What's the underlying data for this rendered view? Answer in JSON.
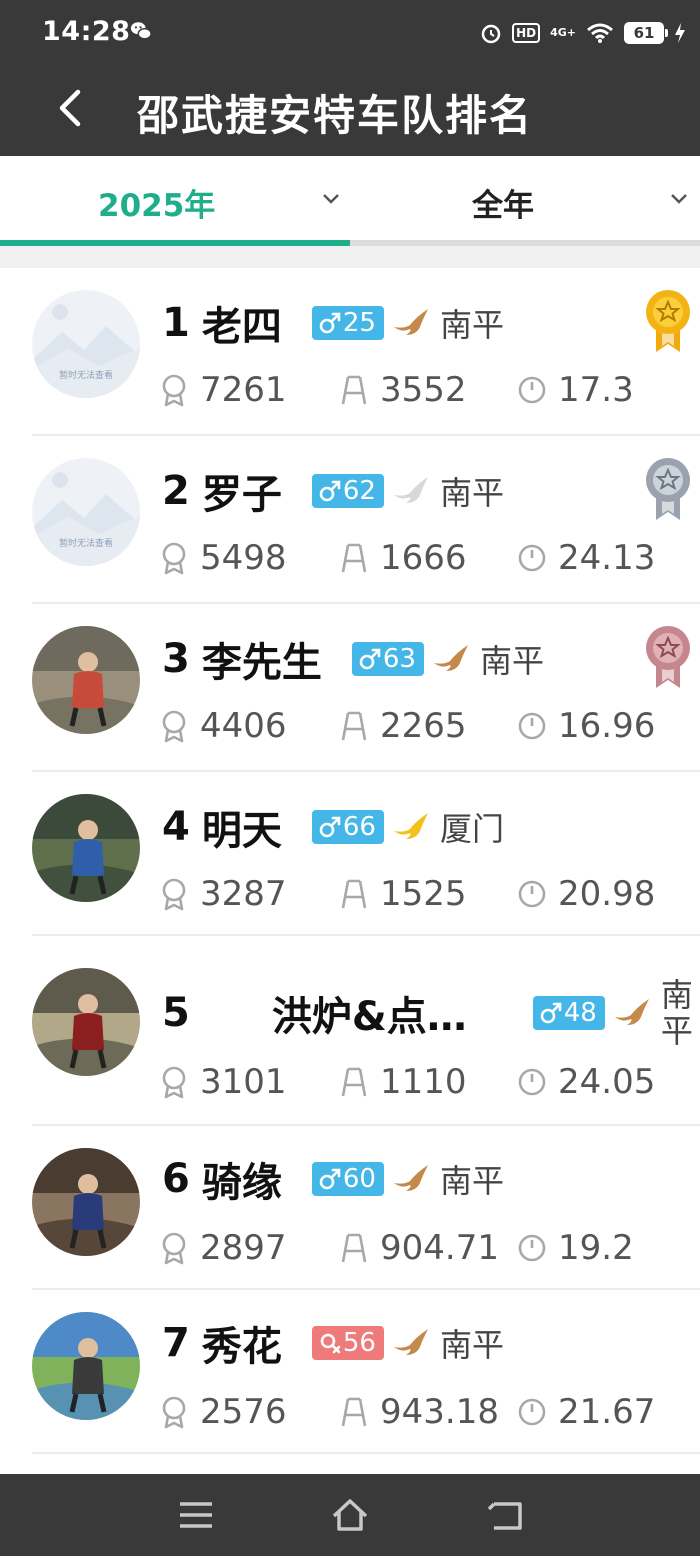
{
  "status": {
    "time": "14:28",
    "network": "4G+",
    "battery": "61"
  },
  "header": {
    "title": "邵武捷安特车队排名"
  },
  "tabs": [
    {
      "label": "2025年",
      "active": true
    },
    {
      "label": "全年",
      "active": false
    }
  ],
  "avatar_placeholder_text": "暂时无法查看",
  "colors": {
    "accent": "#1fae8c",
    "male_badge": "#45b6e8",
    "female_badge": "#ef7a7a",
    "header_bg": "#393939"
  },
  "riders": [
    {
      "rank": "1",
      "name": "老四",
      "gender": "male",
      "age": "25",
      "bird": "brown",
      "city": "南平",
      "stat1": "7261",
      "stat2": "3552",
      "stat3": "17.3",
      "medal": "gold",
      "avatar": "placeholder"
    },
    {
      "rank": "2",
      "name": "罗子",
      "gender": "male",
      "age": "62",
      "bird": "white",
      "city": "南平",
      "stat1": "5498",
      "stat2": "1666",
      "stat3": "24.13",
      "medal": "silver",
      "avatar": "placeholder"
    },
    {
      "rank": "3",
      "name": "李先生",
      "gender": "male",
      "age": "63",
      "bird": "brown",
      "city": "南平",
      "stat1": "4406",
      "stat2": "2265",
      "stat3": "16.96",
      "medal": "bronze",
      "avatar": "photo"
    },
    {
      "rank": "4",
      "name": "明天",
      "gender": "male",
      "age": "66",
      "bird": "yellow",
      "city": "厦门",
      "stat1": "3287",
      "stat2": "1525",
      "stat3": "20.98",
      "medal": "",
      "avatar": "photo"
    },
    {
      "rank": "5",
      "name": "洪炉&点…",
      "gender": "male",
      "age": "48",
      "bird": "brown",
      "city": "南平",
      "stat1": "3101",
      "stat2": "1110",
      "stat3": "24.05",
      "medal": "",
      "avatar": "photo"
    },
    {
      "rank": "6",
      "name": "骑缘",
      "gender": "male",
      "age": "60",
      "bird": "brown",
      "city": "南平",
      "stat1": "2897",
      "stat2": "904.71",
      "stat3": "19.2",
      "medal": "",
      "avatar": "photo"
    },
    {
      "rank": "7",
      "name": "秀花",
      "gender": "female",
      "age": "56",
      "bird": "brown",
      "city": "南平",
      "stat1": "2576",
      "stat2": "943.18",
      "stat3": "21.67",
      "medal": "",
      "avatar": "photo"
    }
  ],
  "navbar": {
    "icons": [
      "menu-icon",
      "home-icon",
      "back-icon"
    ]
  }
}
